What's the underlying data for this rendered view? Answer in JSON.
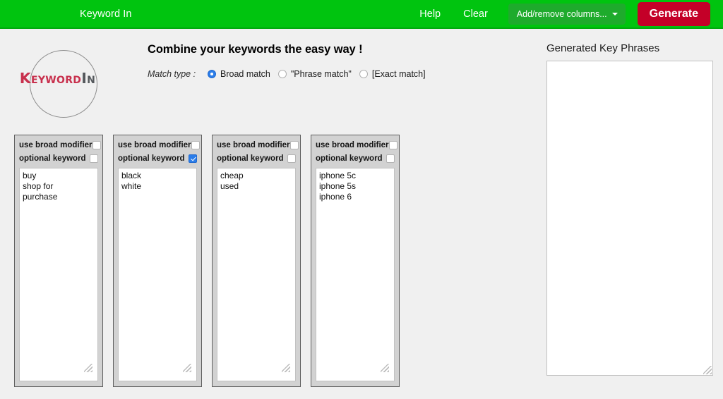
{
  "navbar": {
    "brand": "Keyword In",
    "help_label": "Help",
    "clear_label": "Clear",
    "columns_label": "Add/remove columns...",
    "generate_label": "Generate",
    "bg_color": "#00c40f",
    "columns_btn_color": "#1eab2c",
    "generate_btn_color": "#c40028"
  },
  "logo": {
    "primary_text": "Keyword",
    "secondary_text": "In",
    "primary_color": "#c8304d",
    "secondary_color": "#54585c"
  },
  "main": {
    "headline": "Combine your keywords the easy way !",
    "match_type_label": "Match type :",
    "match_options": [
      {
        "label": "Broad match",
        "selected": true
      },
      {
        "label": "\"Phrase match\"",
        "selected": false
      },
      {
        "label": "[Exact match]",
        "selected": false
      }
    ],
    "accent_color": "#2b7de9"
  },
  "columns": [
    {
      "broad_modifier_label": "use broad modifier",
      "broad_modifier_checked": false,
      "optional_keyword_label": "optional keyword",
      "optional_keyword_checked": false,
      "keywords": "buy\nshop for\npurchase"
    },
    {
      "broad_modifier_label": "use broad modifier",
      "broad_modifier_checked": false,
      "optional_keyword_label": "optional keyword",
      "optional_keyword_checked": true,
      "keywords": "black\nwhite"
    },
    {
      "broad_modifier_label": "use broad modifier",
      "broad_modifier_checked": false,
      "optional_keyword_label": "optional keyword",
      "optional_keyword_checked": false,
      "keywords": "cheap\nused"
    },
    {
      "broad_modifier_label": "use broad modifier",
      "broad_modifier_checked": false,
      "optional_keyword_label": "optional keyword",
      "optional_keyword_checked": false,
      "keywords": "iphone 5c\niphone 5s\niphone 6"
    }
  ],
  "output": {
    "title": "Generated Key Phrases",
    "value": ""
  }
}
